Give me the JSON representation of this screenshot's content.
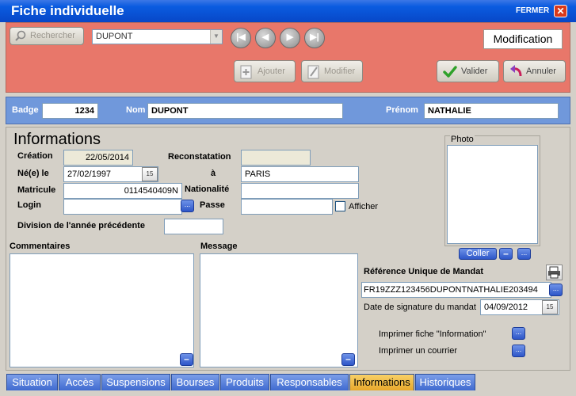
{
  "window": {
    "title": "Fiche individuelle",
    "close_label": "FERMER",
    "close_glyph": "✕"
  },
  "toolbar": {
    "search_label": "Rechercher",
    "name_combo": "DUPONT",
    "nav": {
      "first": "|◀",
      "prev": "◀",
      "next": "▶",
      "last": "▶|"
    },
    "add_label": "Ajouter",
    "modify_label": "Modifier",
    "validate_label": "Valider",
    "cancel_label": "Annuler",
    "mode": "Modification"
  },
  "identity": {
    "badge_label": "Badge",
    "badge_value": "1234",
    "nom_label": "Nom",
    "nom_value": "DUPONT",
    "prenom_label": "Prénom",
    "prenom_value": "NATHALIE"
  },
  "info": {
    "heading": "Informations",
    "creation_label": "Création",
    "creation_value": "22/05/2014",
    "reconstatation_label": "Reconstatation",
    "reconstatation_value": "",
    "birth_label": "Né(e) le",
    "birth_value": "27/02/1997",
    "a_label": "à",
    "birthplace_value": "PARIS",
    "matricule_label": "Matricule",
    "matricule_value": "0114540409N",
    "nationalite_label": "Nationalité",
    "nationalite_value": "",
    "login_label": "Login",
    "login_value": "",
    "passe_label": "Passe",
    "passe_value": "",
    "afficher_label": "Afficher",
    "division_label": "Division de l'année précédente",
    "division_value": "",
    "photo_label": "Photo",
    "coller_label": "Coller",
    "commentaires_label": "Commentaires",
    "message_label": "Message",
    "mandat_label": "Référence Unique de Mandat",
    "mandat_value": "FR19ZZZ123456DUPONTNATHALIE203494",
    "signature_label": "Date de signature du mandat",
    "signature_value": "04/09/2012",
    "print_info_label": "Imprimer fiche \"Information\"",
    "print_mail_label": "Imprimer un courrier",
    "dots": "...",
    "minus": "–",
    "cal_glyph": "15"
  },
  "tabs": [
    "Situation",
    "Accès",
    "Suspensions",
    "Bourses",
    "Produits",
    "Responsables",
    "Informations",
    "Historiques"
  ],
  "active_tab": "Informations",
  "colors": {
    "titlebar": "#0a5be0",
    "toolbar": "#e8776a",
    "badge_strip": "#7098db",
    "tab": "#3f6ad0",
    "active_tab": "#e8a82c"
  }
}
